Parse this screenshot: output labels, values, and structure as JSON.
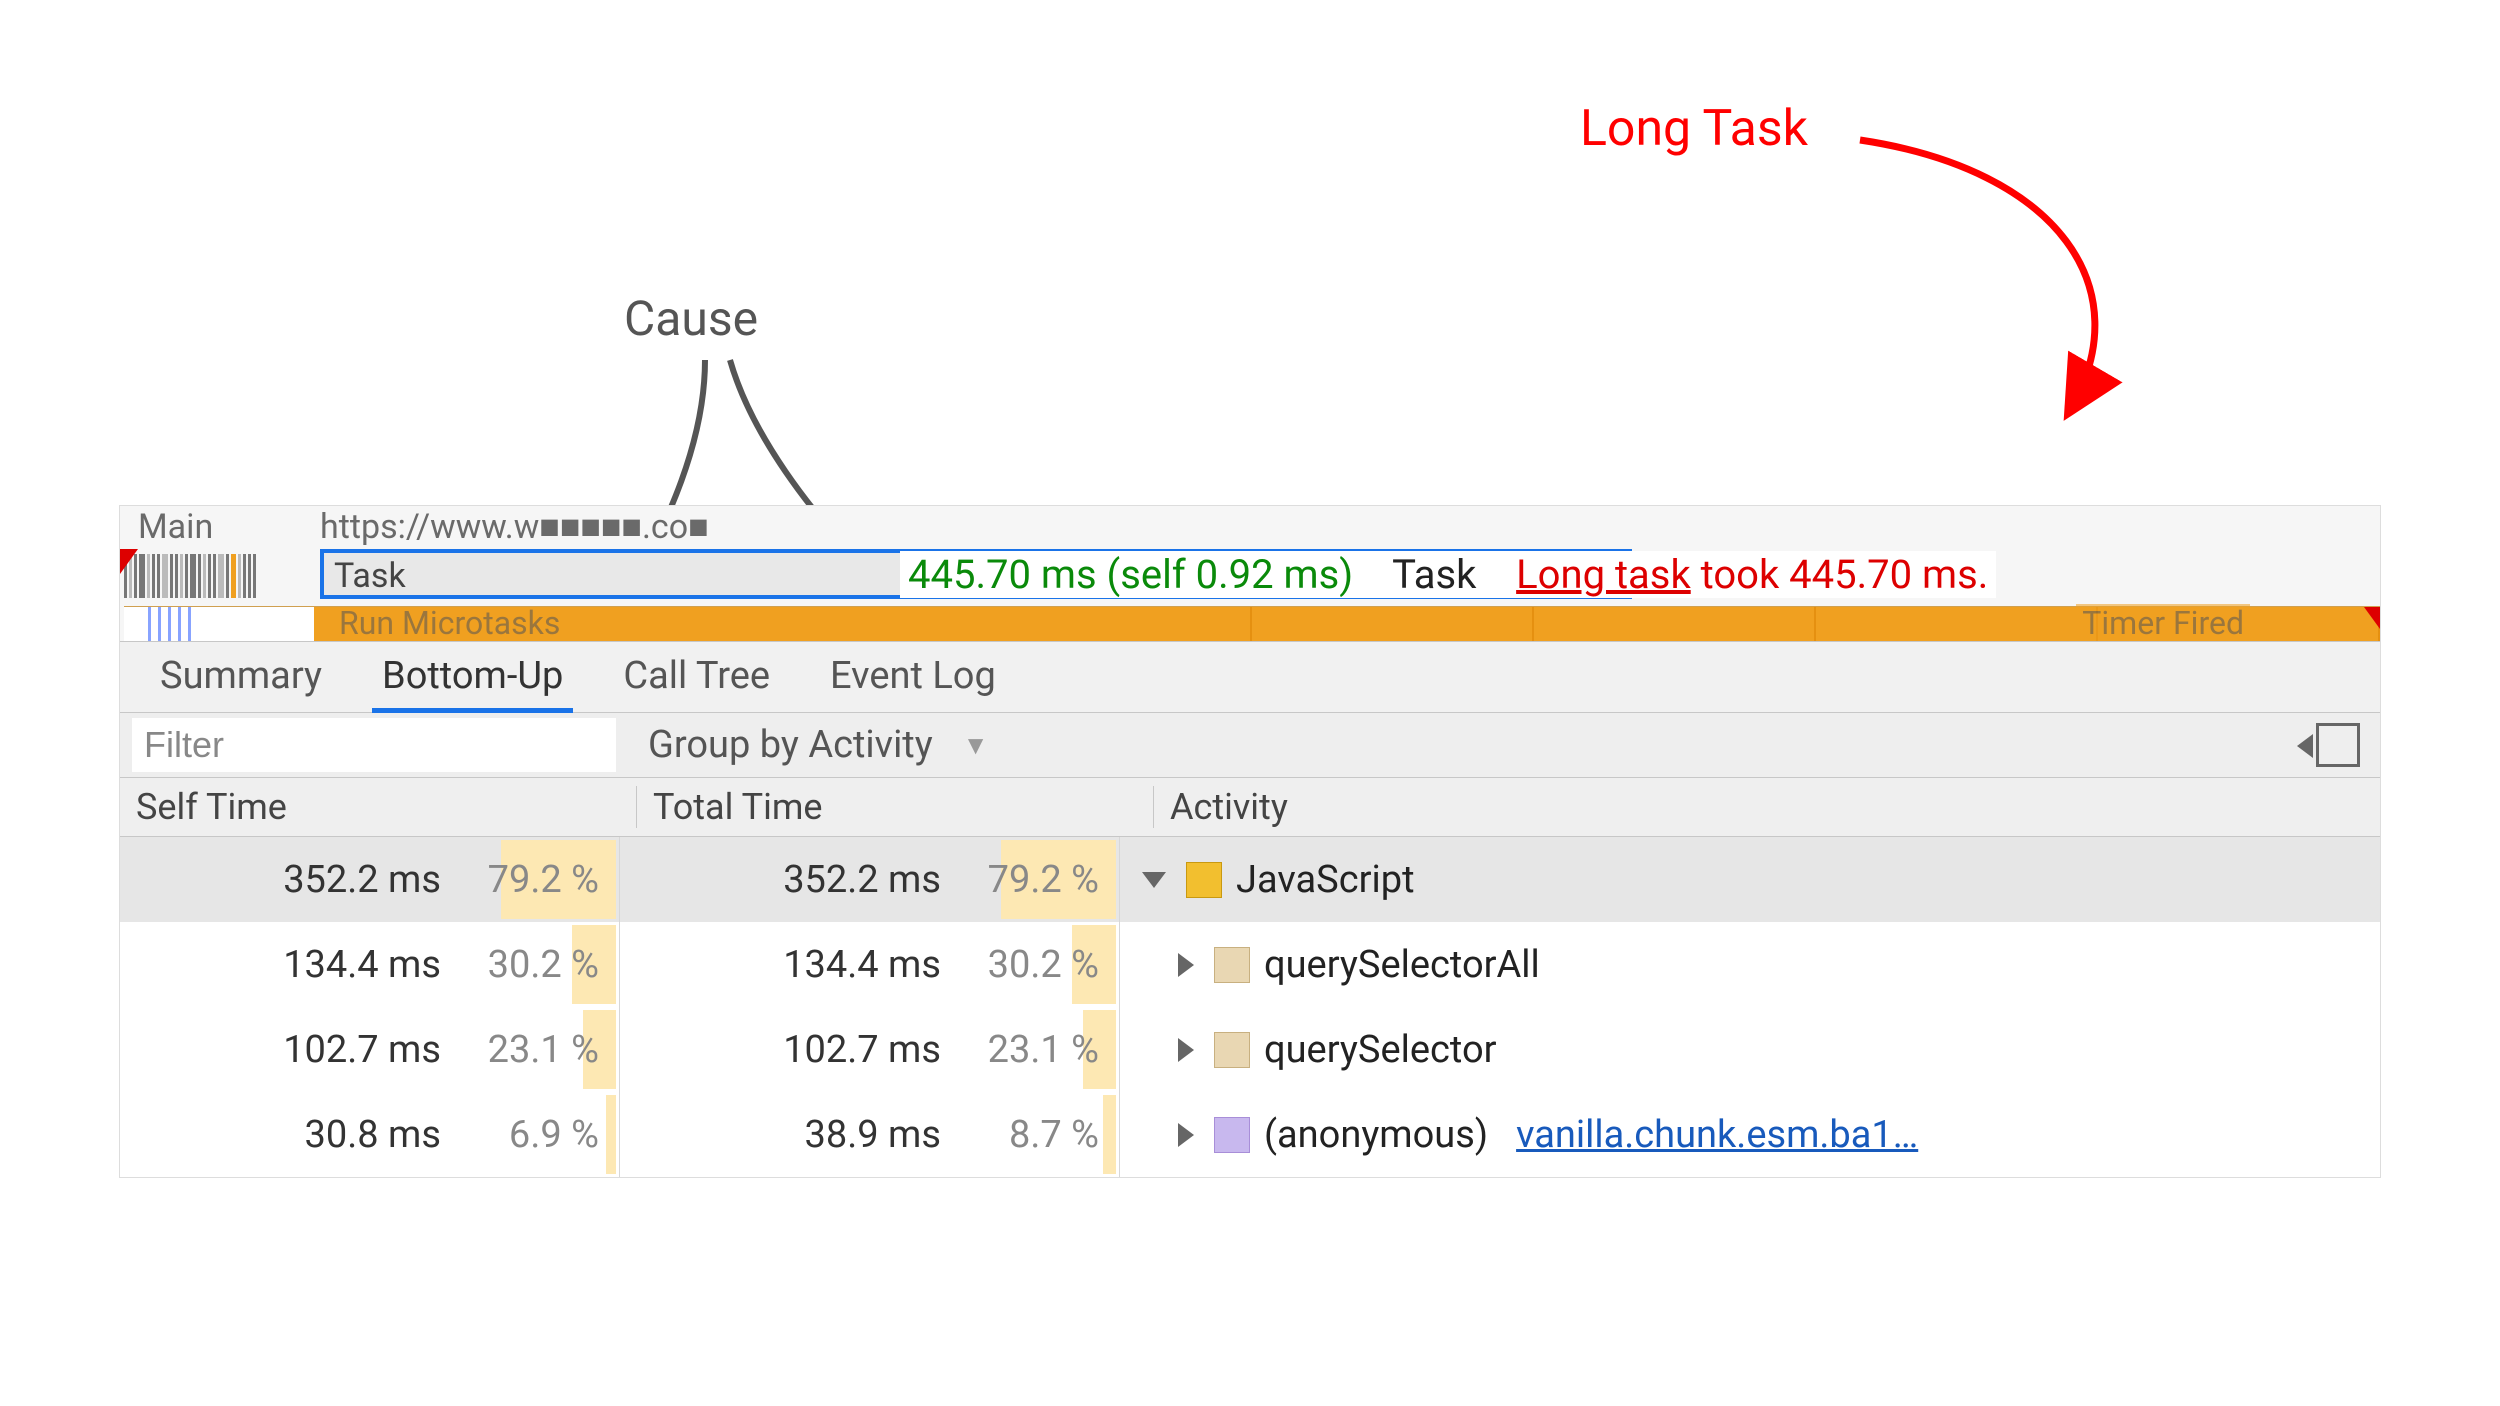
{
  "annotations": {
    "long_task": "Long Task",
    "cause": "Cause"
  },
  "flame": {
    "main_label": "Main",
    "main_url_partial": "https://www.w■■■■■.co■",
    "task_label": "Task",
    "task_duration": "445.70 ms (self 0.92 ms)",
    "task_kind": "Task",
    "long_task_prefix": "Long task",
    "long_task_suffix": " took 445.70 ms.",
    "microtasks_label": "Run Microtasks",
    "timer_fired_label": "Timer Fired"
  },
  "tabs": [
    "Summary",
    "Bottom-Up",
    "Call Tree",
    "Event Log"
  ],
  "active_tab_index": 1,
  "toolbar": {
    "filter_placeholder": "Filter",
    "group_by_label": "Group by Activity"
  },
  "columns": {
    "self": "Self Time",
    "total": "Total Time",
    "activity": "Activity"
  },
  "rows": [
    {
      "self_ms": "352.2 ms",
      "self_pct": "79.2 %",
      "self_bar": 79.2,
      "total_ms": "352.2 ms",
      "total_pct": "79.2 %",
      "total_bar": 79.2,
      "disclosure": "down",
      "swatch": "cb-js",
      "label": "JavaScript",
      "link": "",
      "selected": true,
      "indent": 0
    },
    {
      "self_ms": "134.4 ms",
      "self_pct": "30.2 %",
      "self_bar": 30.2,
      "total_ms": "134.4 ms",
      "total_pct": "30.2 %",
      "total_bar": 30.2,
      "disclosure": "right",
      "swatch": "cb-tan",
      "label": "querySelectorAll",
      "link": "",
      "selected": false,
      "indent": 1
    },
    {
      "self_ms": "102.7 ms",
      "self_pct": "23.1 %",
      "self_bar": 23.1,
      "total_ms": "102.7 ms",
      "total_pct": "23.1 %",
      "total_bar": 23.1,
      "disclosure": "right",
      "swatch": "cb-tan",
      "label": "querySelector",
      "link": "",
      "selected": false,
      "indent": 1
    },
    {
      "self_ms": "30.8 ms",
      "self_pct": "6.9 %",
      "self_bar": 6.9,
      "total_ms": "38.9 ms",
      "total_pct": "8.7 %",
      "total_bar": 8.7,
      "disclosure": "right",
      "swatch": "cb-pur",
      "label": "(anonymous)",
      "link": "vanilla.chunk.esm.ba1…",
      "selected": false,
      "indent": 1
    }
  ]
}
